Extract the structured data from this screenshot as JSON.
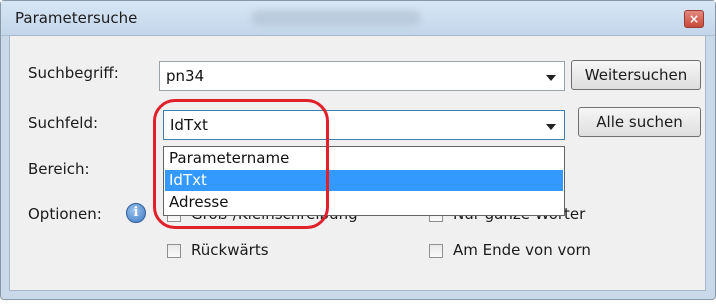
{
  "window": {
    "title": "Parametersuche",
    "close_symbol": "×"
  },
  "form": {
    "search_term_label": "Suchbegriff:",
    "search_term_value": "pn34",
    "field_label": "Suchfeld:",
    "field_value": "IdTxt",
    "range_label": "Bereich:",
    "options_label": "Optionen:"
  },
  "buttons": {
    "find_next": "Weitersuchen",
    "find_all": "Alle suchen"
  },
  "dropdown": {
    "options": [
      "Parametername",
      "IdTxt",
      "Adresse"
    ],
    "selected": "IdTxt"
  },
  "options": {
    "case_sensitive": "Groß-/Kleinschreibung",
    "whole_words": "Nur ganze Wörter",
    "backwards": "Rückwärts",
    "wrap_around": "Am Ende von vorn"
  },
  "colors": {
    "selection": "#3399ff",
    "annotation": "#e0202a"
  }
}
